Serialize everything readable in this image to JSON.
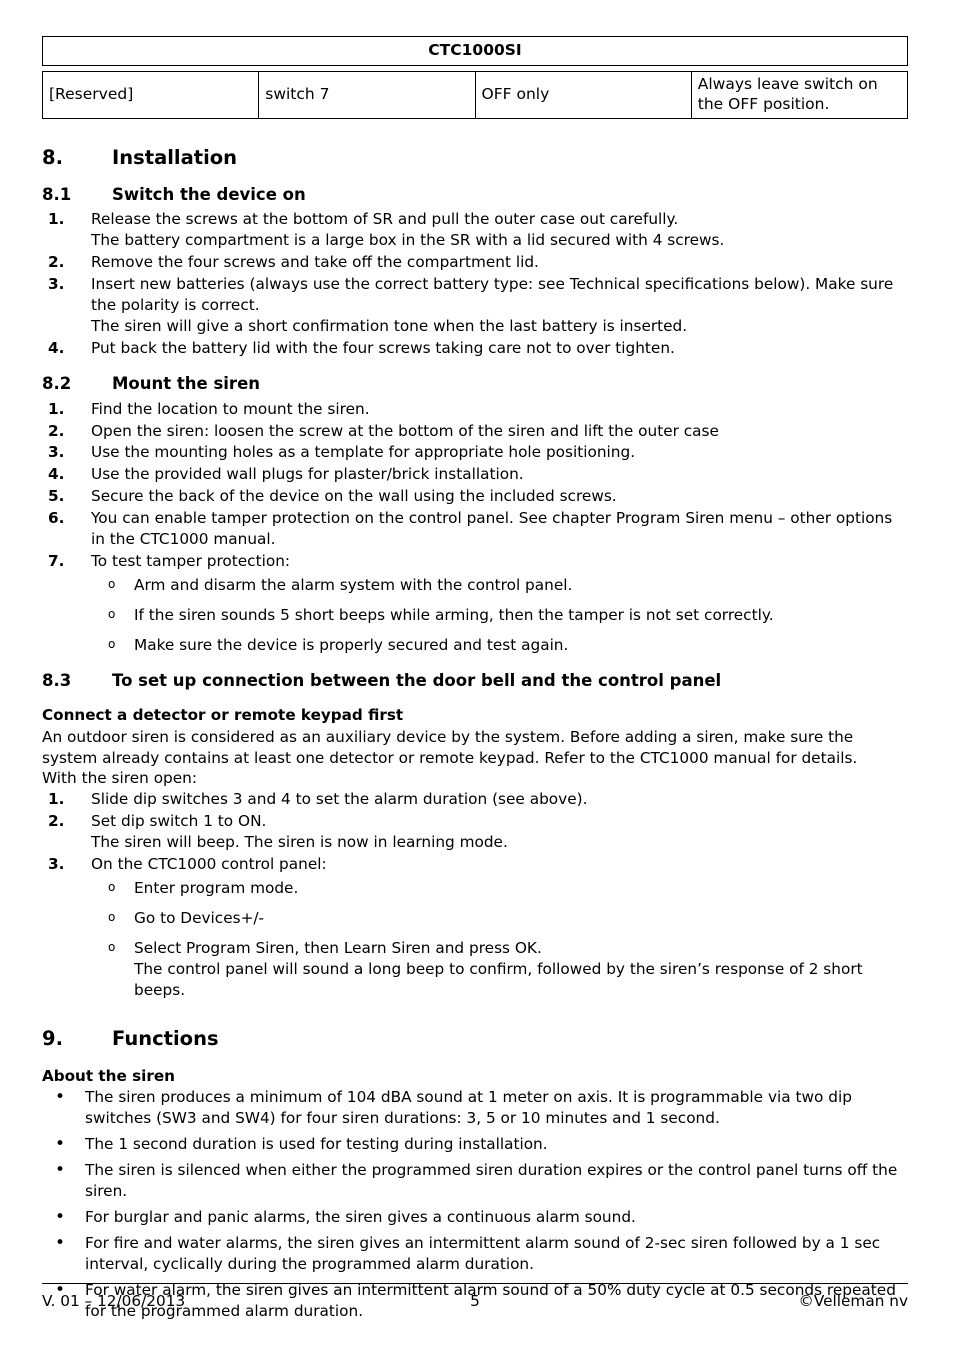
{
  "document": {
    "table": {
      "title": "CTC1000SI",
      "row": {
        "col1": "[Reserved]",
        "col2": "switch 7",
        "col3": "OFF only",
        "col4": "Always leave switch on the OFF position."
      }
    },
    "sections": {
      "installation": {
        "number": "8.",
        "title": "Installation",
        "sub1": {
          "number": "8.1",
          "title": "Switch the device on",
          "items": [
            {
              "marker": "1.",
              "line1": "Release the screws at the bottom of SR and pull the outer case out carefully.",
              "line2": "The battery compartment is a large box in the SR with a lid secured with 4 screws."
            },
            {
              "marker": "2.",
              "line1": "Remove the four screws and take off the compartment lid."
            },
            {
              "marker": "3.",
              "line1": "Insert new batteries (always use the correct battery type: see Technical specifications below). Make sure the polarity is correct.",
              "line2": "The siren will give a short confirmation tone when the last battery is inserted."
            },
            {
              "marker": "4.",
              "line1": "Put back the battery lid with the four screws taking care not to over tighten."
            }
          ]
        },
        "sub2": {
          "number": "8.2",
          "title": "Mount the siren",
          "items": [
            {
              "marker": "1.",
              "line1": "Find the location to mount the siren."
            },
            {
              "marker": "2.",
              "line1": "Open the siren: loosen the screw at the bottom of the siren and lift the outer case"
            },
            {
              "marker": "3.",
              "line1": "Use the mounting holes as a template for appropriate hole positioning."
            },
            {
              "marker": "4.",
              "line1": "Use the provided wall plugs for plaster/brick installation."
            },
            {
              "marker": "5.",
              "line1": "Secure the back of the device on the wall using the included screws."
            },
            {
              "marker": "6.",
              "line1": "You can enable tamper protection on the control panel. See chapter Program Siren menu – other options in the CTC1000 manual."
            },
            {
              "marker": "7.",
              "line1": "To test tamper protection:"
            }
          ],
          "subitems": [
            {
              "marker": "o",
              "text": "Arm and disarm the alarm system with the control panel."
            },
            {
              "marker": "o",
              "text": "If the siren sounds 5 short beeps while arming, then the tamper is not set correctly."
            },
            {
              "marker": "o",
              "text": "Make sure the device is properly secured and test again."
            }
          ]
        },
        "sub3": {
          "number": "8.3",
          "title": "To set up connection between the door bell and the control panel",
          "subheading": "Connect a detector or remote keypad first",
          "paragraph": "An outdoor siren is considered as an auxiliary device by the system. Before adding a siren, make sure the system already contains at least one detector or remote keypad. Refer to the CTC1000 manual for details.",
          "paragraph2": "With the siren open:",
          "items": [
            {
              "marker": "1.",
              "line1": "Slide dip switches 3 and 4 to set the alarm duration (see above)."
            },
            {
              "marker": "2.",
              "line1": "Set dip switch 1 to ON.",
              "line2": "The siren will beep. The siren is now in learning mode."
            },
            {
              "marker": "3.",
              "line1": "On the CTC1000 control panel:"
            }
          ],
          "subitems": [
            {
              "marker": "o",
              "text": "Enter program mode."
            },
            {
              "marker": "o",
              "text": "Go to Devices+/-"
            },
            {
              "marker": "o",
              "text": "Select Program Siren, then Learn Siren and press OK.",
              "text2": "The control panel will sound a long beep to confirm, followed by the siren’s response of 2 short beeps."
            }
          ]
        }
      },
      "functions": {
        "number": "9.",
        "title": "Functions",
        "subheading": "About the siren",
        "bullets": [
          {
            "marker": "•",
            "text": "The siren produces a minimum of 104 dBA sound at 1 meter on axis. It is programmable via two dip switches (SW3 and SW4) for four siren durations: 3, 5 or 10 minutes and 1 second."
          },
          {
            "marker": "•",
            "text": "The 1 second duration is used for testing during installation."
          },
          {
            "marker": "•",
            "text": "The siren is silenced when either the programmed siren duration expires or the control panel turns off the siren."
          },
          {
            "marker": "•",
            "text": "For burglar and panic alarms, the siren gives a continuous alarm sound."
          },
          {
            "marker": "•",
            "text": "For fire and water alarms, the siren gives an intermittent alarm sound of 2-sec siren followed by a 1 sec interval, cyclically during the programmed alarm duration."
          },
          {
            "marker": "•",
            "text": "For water alarm, the siren gives an intermittent alarm sound of a 50% duty cycle at 0.5 seconds repeated for the programmed alarm duration."
          }
        ]
      }
    },
    "footer": {
      "version": "V. 01 – 12/06/2013",
      "page_number": "5",
      "copyright": "©Velleman nv"
    }
  }
}
